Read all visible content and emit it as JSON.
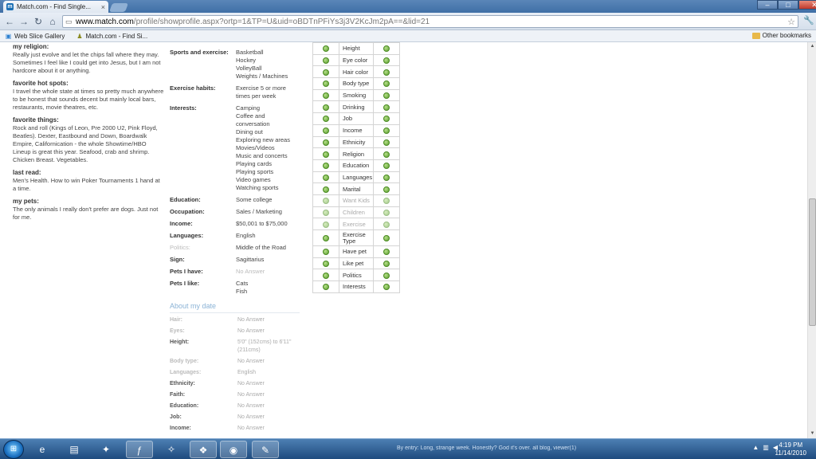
{
  "browser": {
    "tab_title": "Match.com - Find Single...",
    "tab_close": "×",
    "url_host": "www.match.com",
    "url_path": "/profile/showprofile.aspx?ortp=1&TP=U&uid=oBDTnPFiYs3j3V2KcJm2pA==&lid=21",
    "bookmarks": [
      {
        "label": "Web Slice Gallery"
      },
      {
        "label": "Match.com - Find Si..."
      }
    ],
    "other_bookmarks": "Other bookmarks"
  },
  "left": [
    {
      "heading": "my religion:",
      "text": "Really just evolve and let the chips fall where they may. Sometimes I feel like I could get into Jesus, but I am not hardcore about it or anything."
    },
    {
      "heading": "favorite hot spots:",
      "text": "I travel the whole state at times so pretty much anywhere to be honest that sounds decent but mainly local bars, restaurants, movie theatres, etc."
    },
    {
      "heading": "favorite things:",
      "text": "Rock and roll (Kings of Leon, Pre 2000 U2, Pink Floyd, Beatles). Dexter, Eastbound and Down, Boardwalk Empire, Californication - the whole Showtime/HBO Lineup is great this year. Seafood, crab and shrimp. Chicken Breast. Vegetables."
    },
    {
      "heading": "last read:",
      "text": "Men's Health. How to win Poker Tournaments 1 hand at a time."
    },
    {
      "heading": "my pets:",
      "text": "The only animals I really don't prefer are dogs. Just not for me."
    }
  ],
  "details": {
    "sports_label": "Sports and exercise:",
    "sports": [
      "Basketball",
      "Hockey",
      "VolleyBall",
      "Weights / Machines"
    ],
    "exercise_label": "Exercise habits:",
    "exercise": "Exercise 5 or more times per week",
    "interests_label": "Interests:",
    "interests": [
      "Camping",
      "Coffee and conversation",
      "Dining out",
      "Exploring new areas",
      "Movies/Videos",
      "Music and concerts",
      "Playing cards",
      "Playing sports",
      "Video games",
      "Watching sports"
    ],
    "education_label": "Education:",
    "education": "Some college",
    "occupation_label": "Occupation:",
    "occupation": "Sales / Marketing",
    "income_label": "Income:",
    "income": "$50,001 to $75,000",
    "languages_label": "Languages:",
    "languages": "English",
    "politics_label": "Politics:",
    "politics": "Middle of the Road",
    "sign_label": "Sign:",
    "sign": "Sagittarius",
    "pets_have_label": "Pets I have:",
    "pets_have": "No Answer",
    "pets_like_label": "Pets I like:",
    "pets_like": [
      "Cats",
      "Fish"
    ]
  },
  "about_date": {
    "title": "About my date",
    "hair_label": "Hair:",
    "hair": "No Answer",
    "eyes_label": "Eyes:",
    "eyes": "No Answer",
    "height_label": "Height:",
    "height": "5'0\" (152cms) to 6'11\" (211cms)",
    "body_label": "Body type:",
    "body": "No Answer",
    "languages_label": "Languages:",
    "languages": "English",
    "ethnicity_label": "Ethnicity:",
    "ethnicity": "No Answer",
    "faith_label": "Faith:",
    "faith": "No Answer",
    "education_label": "Education:",
    "education": "No Answer",
    "job_label": "Job:",
    "job": "No Answer",
    "income_label": "Income:",
    "income": "No Answer"
  },
  "match_rows": [
    "Height",
    "Eye color",
    "Hair color",
    "Body type",
    "Smoking",
    "Drinking",
    "Job",
    "Income",
    "Ethnicity",
    "Religion",
    "Education",
    "Languages",
    "Marital",
    "Want Kids",
    "Children",
    "Exercise",
    "Exercise Type",
    "Have pet",
    "Like pet",
    "Politics",
    "Interests"
  ],
  "taskbar": {
    "start": "⊞",
    "ticker": "By entry: Long, strange week. Honestly? God it's over. all blog, viewer(1)",
    "time": "4:19 PM",
    "date": "11/14/2010"
  }
}
